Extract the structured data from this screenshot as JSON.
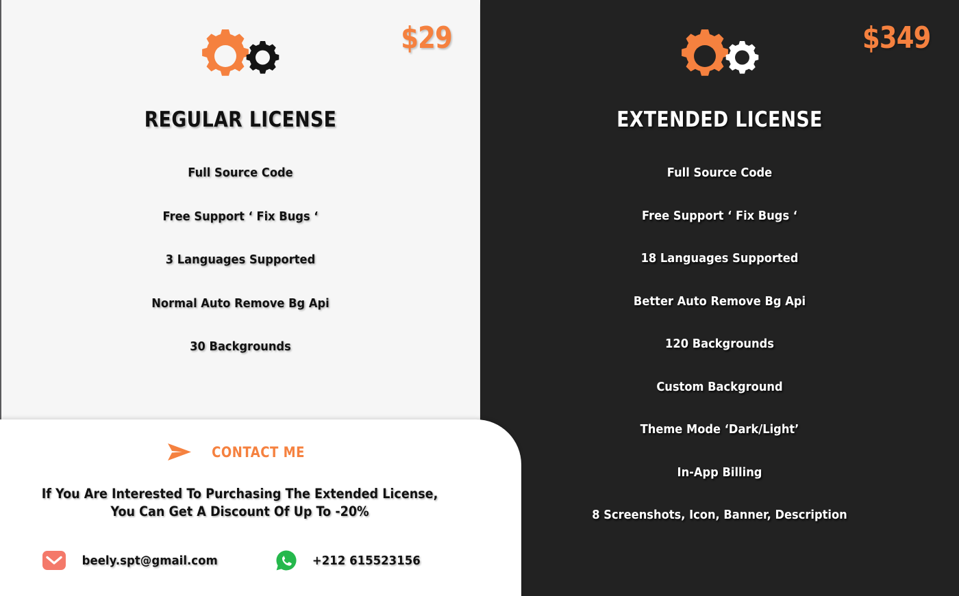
{
  "colors": {
    "accent_orange": "#f5813f",
    "dark_panel": "#222222",
    "light_panel": "#f6f6f6",
    "card_white": "#ffffff",
    "email_icon": "#f4796a",
    "whatsapp_icon": "#25b84c"
  },
  "plans": [
    {
      "id": "regular",
      "title": "REGULAR LICENSE",
      "price": "$29",
      "gear_primary_name": "gear-icon-orange",
      "gear_secondary_name": "gear-icon-black",
      "features": [
        "Full Source Code",
        "Free Support ‘ Fix Bugs ‘",
        "3 Languages Supported",
        "Normal Auto Remove Bg Api",
        "30 Backgrounds"
      ]
    },
    {
      "id": "extended",
      "title": "EXTENDED LICENSE",
      "price": "$349",
      "gear_primary_name": "gear-icon-orange",
      "gear_secondary_name": "gear-icon-white",
      "features": [
        "Full Source Code",
        "Free Support ‘ Fix Bugs ‘",
        "18 Languages Supported",
        "Better Auto Remove Bg Api",
        "120 Backgrounds",
        "Custom Background",
        "Theme Mode ‘Dark/Light’",
        "In-App Billing",
        "8 Screenshots, Icon, Banner, Description"
      ]
    }
  ],
  "contact": {
    "heading": "CONTACT ME",
    "send_icon": "send-icon",
    "note_line1": "If You Are Interested To Purchasing The Extended License,",
    "note_line2": "You Can Get A Discount Of Up To -20%",
    "email": "beely.spt@gmail.com",
    "email_icon": "email-icon",
    "phone": "+212 615523156",
    "phone_icon": "whatsapp-icon"
  }
}
